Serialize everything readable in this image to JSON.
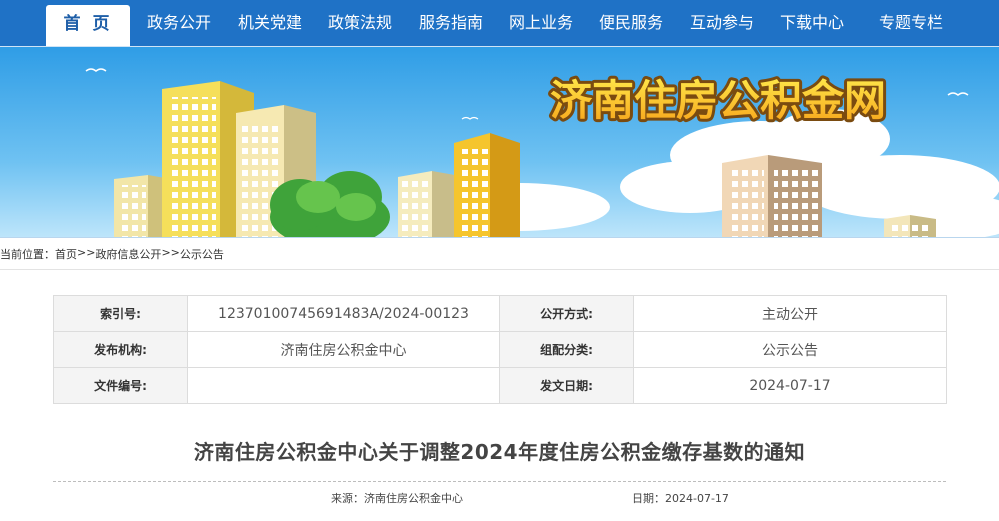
{
  "nav": {
    "items": [
      "首 页",
      "政务公开",
      "机关党建",
      "政策法规",
      "服务指南",
      "网上业务",
      "便民服务",
      "互动参与",
      "下载中心",
      "专题专栏"
    ],
    "active_index": 0,
    "colors": {
      "bar": "#1f72c6",
      "active_text": "#1f5fa8"
    }
  },
  "banner": {
    "title": "济南住房公积金网"
  },
  "breadcrumb": {
    "prefix": "当前位置：",
    "items": [
      "首页",
      "政府信息公开",
      "公示公告"
    ],
    "separator": ">>"
  },
  "info": {
    "index_label": "索引号:",
    "index_value": "12370100745691483A/2024-00123",
    "open_label": "公开方式:",
    "open_value": "主动公开",
    "publisher_label": "发布机构:",
    "publisher_value": "济南住房公积金中心",
    "category_label": "组配分类:",
    "category_value": "公示公告",
    "docno_label": "文件编号:",
    "docno_value": "",
    "date_label": "发文日期:",
    "date_value": "2024-07-17"
  },
  "article": {
    "title": "济南住房公积金中心关于调整2024年度住房公积金缴存基数的通知",
    "source_label": "来源：",
    "source_value": "济南住房公积金中心",
    "date_label": "日期：",
    "date_value": "2024-07-17"
  }
}
